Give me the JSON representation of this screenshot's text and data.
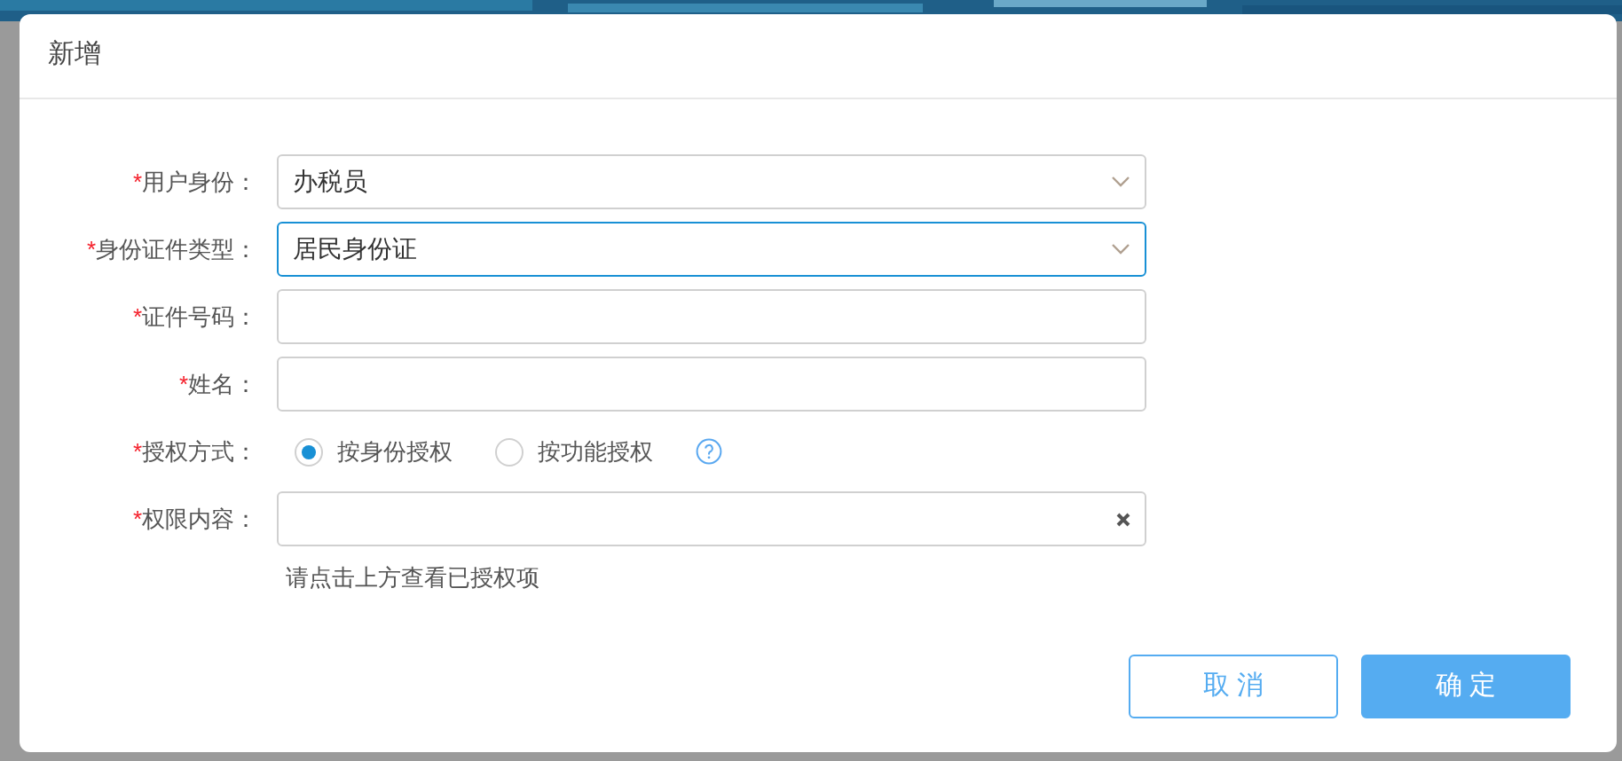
{
  "dialog": {
    "title": "新增"
  },
  "form": {
    "fields": [
      {
        "kind": "select",
        "required_mark": "*",
        "label": "用户身份：",
        "value": "办税员",
        "focused": false
      },
      {
        "kind": "select",
        "required_mark": "*",
        "label": "身份证件类型：",
        "value": "居民身份证",
        "focused": true
      },
      {
        "kind": "text",
        "required_mark": "*",
        "label": "证件号码：",
        "focused": false
      },
      {
        "kind": "text",
        "required_mark": "*",
        "label": "姓名：",
        "focused": false
      },
      {
        "kind": "radio",
        "required_mark": "*",
        "label": "授权方式：",
        "options": [
          {
            "label": "按身份授权",
            "selected": true
          },
          {
            "label": "按功能授权",
            "selected": false
          }
        ],
        "help": true
      },
      {
        "kind": "clearable",
        "required_mark": "*",
        "label": "权限内容：",
        "focused": false,
        "hint": "请点击上方查看已授权项"
      }
    ]
  },
  "buttons": [
    {
      "label": "取 消",
      "kind": "secondary"
    },
    {
      "label": "确 定",
      "kind": "primary"
    }
  ]
}
